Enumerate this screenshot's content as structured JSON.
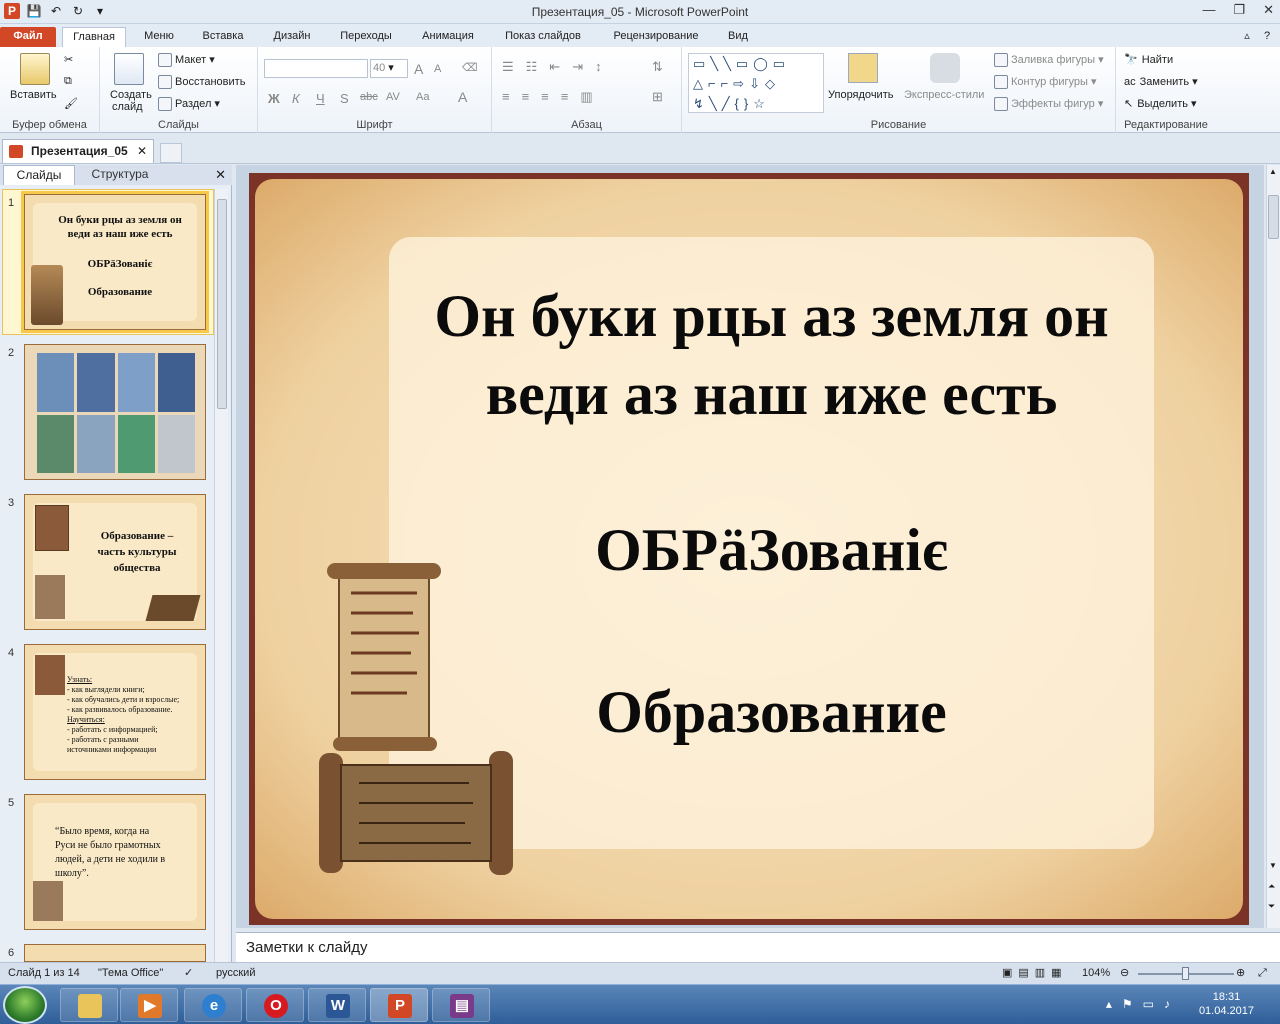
{
  "window": {
    "title": "Презентация_05 - Microsoft PowerPoint",
    "minimize": "—",
    "restore": "❐",
    "close": "✕"
  },
  "qat": {
    "logo": "P",
    "save_icon": "save-icon",
    "undo_icon": "undo-icon",
    "redo_icon": "redo-icon"
  },
  "tabs": [
    "Файл",
    "Главная",
    "Меню",
    "Вставка",
    "Дизайн",
    "Переходы",
    "Анимация",
    "Показ слайдов",
    "Рецензирование",
    "Вид"
  ],
  "ribbon": {
    "clipboard": {
      "label": "Буфер обмена",
      "paste": "Вставить"
    },
    "slides": {
      "label": "Слайды",
      "new_slide_1": "Создать",
      "new_slide_2": "слайд",
      "layout": "Макет",
      "reset": "Восстановить",
      "section": "Раздел"
    },
    "font": {
      "label": "Шрифт",
      "font_name": "",
      "font_size": "40",
      "bold": "Ж",
      "italic": "К",
      "underline": "Ч",
      "shadow": "S",
      "strike": "abc",
      "spacing": "AV",
      "case": "Aa",
      "color": "A",
      "grow": "A",
      "shrink": "A"
    },
    "paragraph": {
      "label": "Абзац"
    },
    "drawing": {
      "label": "Рисование",
      "arrange": "Упорядочить",
      "quick_styles": "Экспресс-стили",
      "fill": "Заливка фигуры",
      "outline": "Контур фигуры",
      "effects": "Эффекты фигур"
    },
    "editing": {
      "label": "Редактирование",
      "find": "Найти",
      "replace": "Заменить",
      "select": "Выделить"
    }
  },
  "doc_tab": {
    "name": "Презентация_05",
    "close": "✕"
  },
  "left_pane": {
    "tabs": {
      "slides": "Слайды",
      "outline": "Структура",
      "close": "✕"
    },
    "thumbs": [
      {
        "num": "1",
        "line1": "Он буки рцы  аз земля он",
        "line2": "веди аз наш иже есть",
        "line3": "ОБРӓЗованіє",
        "line4": "Образование"
      },
      {
        "num": "2"
      },
      {
        "num": "3",
        "line1": "Образование –",
        "line2": "часть культуры",
        "line3": "общества"
      },
      {
        "num": "4",
        "lines": [
          "Узнать:",
          "- как выглядели книги;",
          "- как обучались дети и взрослые;",
          "- как развивалось образование.",
          "Научиться:",
          "- работать с информацией;",
          "- работать с разными",
          "источниками информации"
        ]
      },
      {
        "num": "5",
        "lines": [
          "“Было время, когда на",
          "Руси не было грамотных",
          "людей, а дети не ходили  в",
          "школу”."
        ]
      },
      {
        "num": "6"
      }
    ]
  },
  "slide": {
    "line1": "Он буки рцы аз земля он",
    "line2": "веди аз наш иже есть",
    "line3": "ОБРӓЗованіє",
    "line4": "Образование"
  },
  "notes_placeholder": "Заметки к слайду",
  "status": {
    "slide_info": "Слайд 1 из 14",
    "theme": "\"Тема Office\"",
    "language": "русский",
    "zoom": "104%"
  },
  "taskbar": {
    "time": "18:31",
    "date": "01.04.2017",
    "apps": [
      "Проводник",
      "Медиаплеер",
      "Internet Explorer",
      "Opera",
      "Word",
      "PowerPoint",
      "WinRAR"
    ]
  },
  "colors": {
    "accent": "#d24726",
    "slide_frame": "#7a3326",
    "parchment": "#f6e3c1"
  }
}
